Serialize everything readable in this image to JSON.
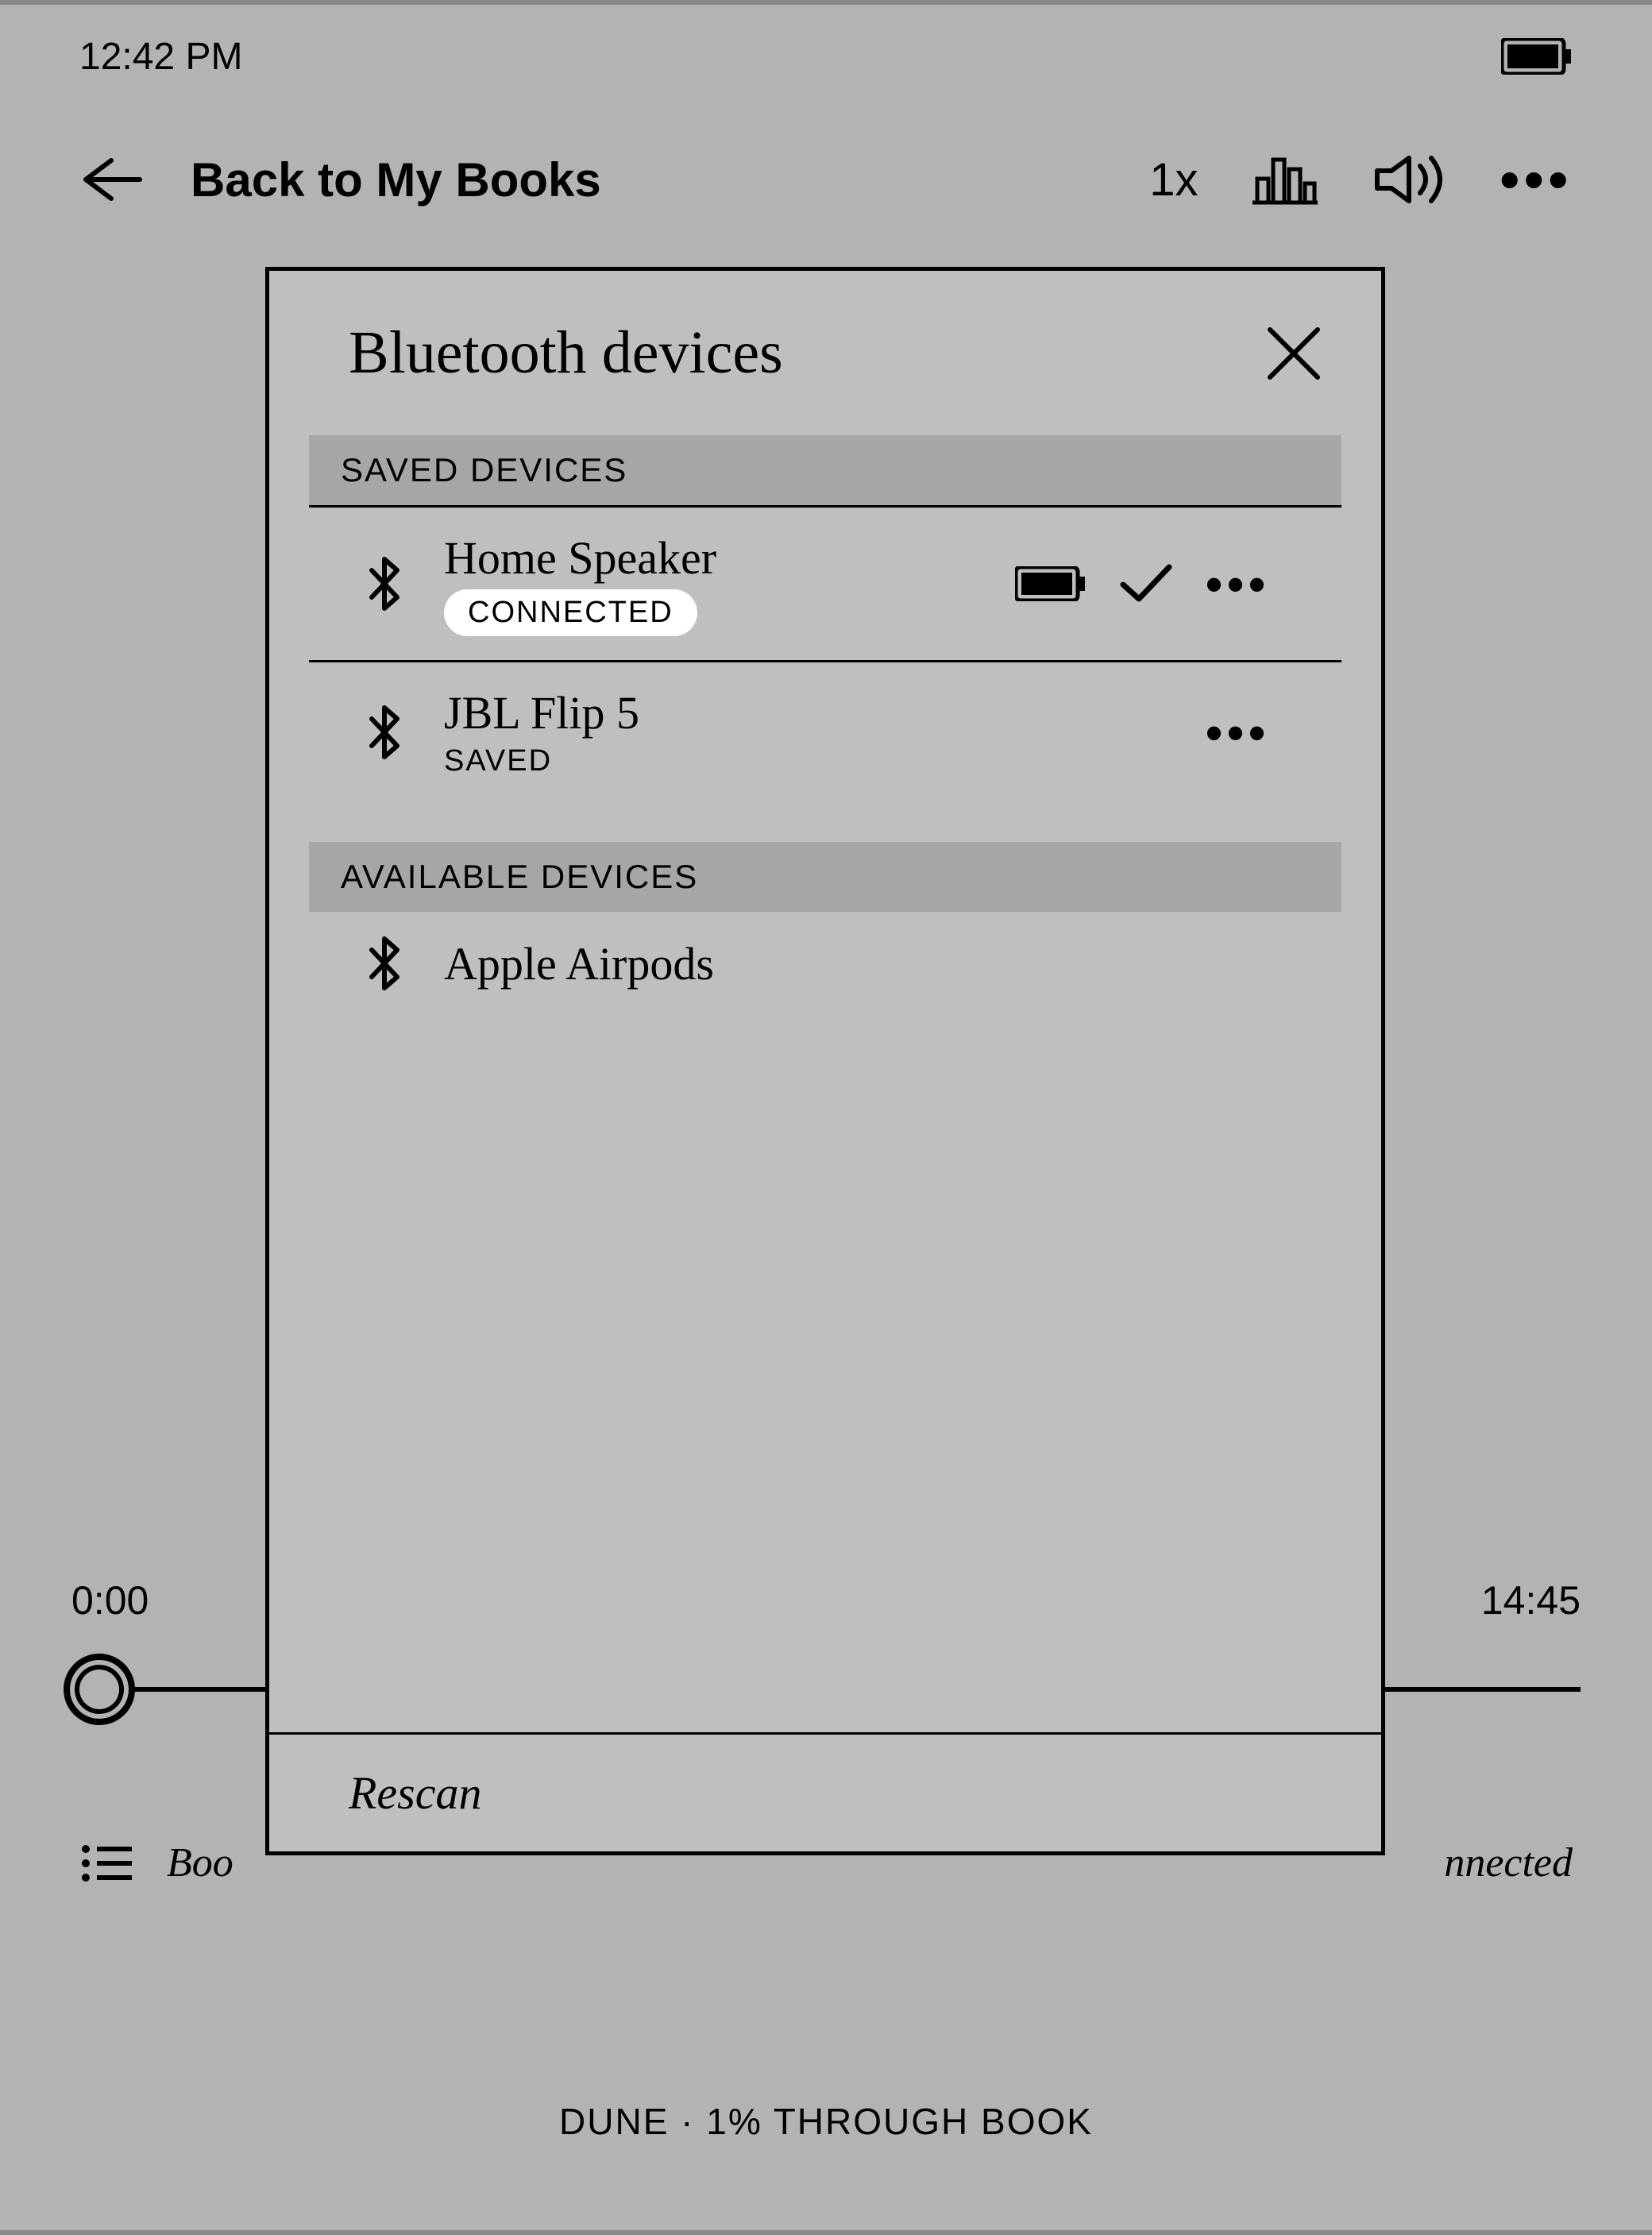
{
  "statusbar": {
    "time": "12:42 PM"
  },
  "topnav": {
    "back_label": "Back to My Books",
    "speed": "1x"
  },
  "scrubber": {
    "elapsed": "0:00",
    "remaining": "14:45"
  },
  "bottom": {
    "left_partial": "Boo",
    "right_partial": "nnected"
  },
  "footer": {
    "progress": "DUNE · 1% THROUGH BOOK"
  },
  "dialog": {
    "title": "Bluetooth devices",
    "section_saved": "SAVED DEVICES",
    "section_available": "AVAILABLE DEVICES",
    "rescan": "Rescan",
    "saved": [
      {
        "name": "Home Speaker",
        "status": "CONNECTED",
        "connected": true
      },
      {
        "name": "JBL Flip 5",
        "status": "SAVED",
        "connected": false
      }
    ],
    "available": [
      {
        "name": "Apple Airpods"
      }
    ]
  }
}
